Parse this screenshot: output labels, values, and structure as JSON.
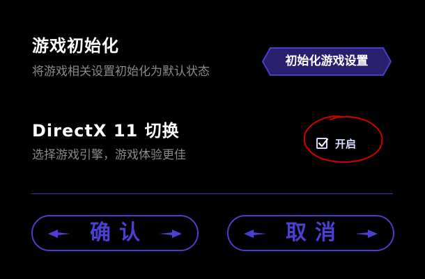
{
  "settings": {
    "init": {
      "title": "游戏初始化",
      "description": "将游戏相关设置初始化为默认状态",
      "button_label": "初始化游戏设置"
    },
    "directx": {
      "title": "DirectX 11 切换",
      "description": "选择游戏引擎，游戏体验更佳",
      "toggle_label": "开启",
      "enabled": true
    }
  },
  "footer": {
    "confirm_label": "确认",
    "cancel_label": "取消"
  },
  "colors": {
    "background": "#000000",
    "accent": "#4a3fc8",
    "hex_button_fill": "#2a1f6e",
    "subtitle_text": "#8a8a8a",
    "annotation_red": "#d40000"
  },
  "icons": {
    "checkbox": "check-icon",
    "arrows": "arrow-left-icon / arrow-right-icon"
  }
}
